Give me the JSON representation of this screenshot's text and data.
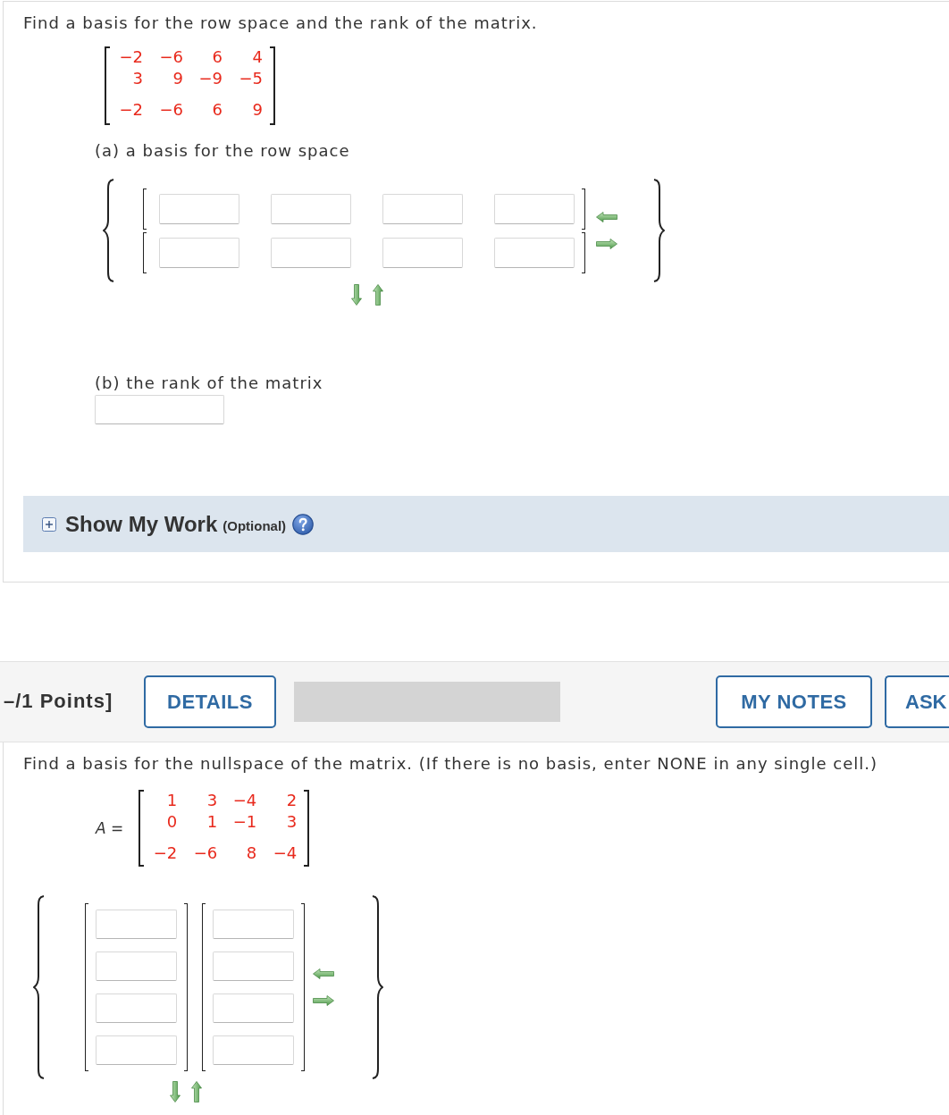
{
  "question_1": {
    "prompt": "Find a basis for the row space and the rank of the matrix.",
    "matrix": {
      "rows": [
        [
          "−2",
          "−6",
          "6",
          "4"
        ],
        [
          "3",
          "9",
          "−9",
          "−5"
        ],
        [
          "−2",
          "−6",
          "6",
          "9"
        ]
      ]
    },
    "part_a": {
      "label": "(a) a basis for the row space",
      "vectors": [
        {
          "fields": [
            {
              "kind": "input"
            },
            {
              "kind": "input"
            },
            {
              "kind": "input"
            },
            {
              "kind": "input"
            }
          ]
        },
        {
          "fields": [
            {
              "kind": "input"
            },
            {
              "kind": "input"
            },
            {
              "kind": "input"
            },
            {
              "kind": "input"
            }
          ]
        }
      ]
    },
    "part_b": {
      "label": "(b) the rank of the matrix",
      "answer": {
        "kind": "input"
      }
    },
    "show_my_work": {
      "title": "Show My Work",
      "note": "(Optional)",
      "expanded": false
    }
  },
  "question_2": {
    "header": {
      "points": "–/1 Points]",
      "buttons_left": [
        "DETAILS"
      ],
      "buttons_right": [
        "MY NOTES",
        "ASK"
      ]
    },
    "prompt": "Find a basis for the nullspace of the matrix. (If there is no basis, enter NONE in any single cell.)",
    "matrix": {
      "label": "*A* =",
      "rows": [
        [
          "1",
          "3",
          "−4",
          "2"
        ],
        [
          "0",
          "1",
          "−1",
          "3"
        ],
        [
          "−2",
          "−6",
          "8",
          "−4"
        ]
      ]
    },
    "vectors": [
      {
        "fields": [
          {
            "kind": "input"
          },
          {
            "kind": "input"
          },
          {
            "kind": "input"
          },
          {
            "kind": "input"
          }
        ]
      },
      {
        "fields": [
          {
            "kind": "input"
          },
          {
            "kind": "input"
          },
          {
            "kind": "input"
          },
          {
            "kind": "input"
          }
        ]
      }
    ]
  }
}
